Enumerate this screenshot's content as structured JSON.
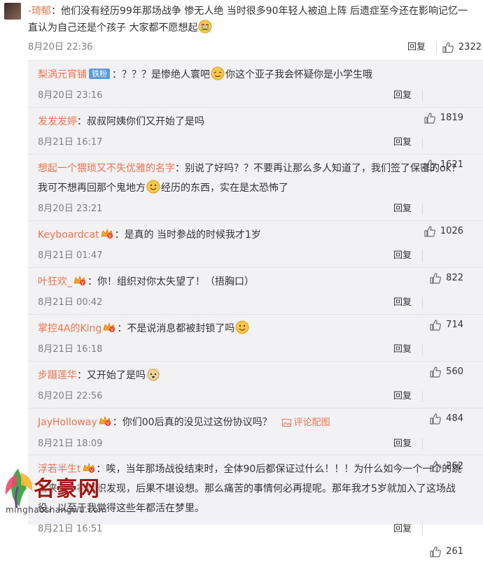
{
  "top_comment": {
    "username": "-琦郁",
    "text_before_emoji": "：他们没有经历99年那场战争 惨无人绝 当时很多90年轻人被迫上阵 后遗症至今还在影响记忆一直认为自己还是个孩子 大家都不愿想起",
    "emoji": "crying-face",
    "time": "8月20日 22:36",
    "reply_label": "回复",
    "likes": "2322"
  },
  "replies": [
    {
      "username": "梨涡元宵铺",
      "badge": "铁粉",
      "vip": false,
      "text": "：？？？是惨绝人寰吧",
      "emoji": "sweat-smile",
      "text_after": "你这个亚子我会怀疑你是小学生哦",
      "time": "8月20日 23:16",
      "reply_label": "回复",
      "likes": "1819"
    },
    {
      "username": "发发发婷",
      "badge": "",
      "vip": false,
      "text": "：叔叔阿姨你们又开始了是吗",
      "emoji": "",
      "text_after": "",
      "time": "8月21日 16:17",
      "reply_label": "回复",
      "likes": "1621"
    },
    {
      "username": "想起一个猥琐又不失优雅的名字",
      "badge": "",
      "vip": false,
      "text": "：别说了好吗？？不要再让那么多人知道了，我们签了保密的ok？我可不想再回那个鬼地方",
      "emoji": "smile",
      "text_after": "经历的东西，实在是太恐怖了",
      "time": "8月20日 23:21",
      "reply_label": "回复",
      "likes": "1026"
    },
    {
      "username": "Keyboardcat",
      "badge": "",
      "vip": true,
      "text": "：是真的 当时参战的时候我才1岁",
      "emoji": "",
      "text_after": "",
      "time": "8月21日 01:47",
      "reply_label": "回复",
      "likes": "822"
    },
    {
      "username": "叶狂欢_",
      "badge": "",
      "vip": true,
      "text": "：你！组织对你太失望了！（捂胸口）",
      "emoji": "",
      "text_after": "",
      "time": "8月21日 00:42",
      "reply_label": "回复",
      "likes": "714"
    },
    {
      "username": "掌控4A的King",
      "badge": "",
      "vip": true,
      "text": "：不是说消息都被封锁了吗",
      "emoji": "smile",
      "text_after": "",
      "time": "8月21日 16:18",
      "reply_label": "回复",
      "likes": "560"
    },
    {
      "username": "步蹑莲华",
      "badge": "",
      "vip": false,
      "text": "：又开始了是吗",
      "emoji": "doge",
      "text_after": "",
      "time": "8月20日 22:56",
      "reply_label": "回复",
      "likes": "484"
    },
    {
      "username": "JayHolloway",
      "badge": "",
      "vip": true,
      "text": "：你们00后真的没见过这份协议吗？",
      "emoji": "",
      "text_after": "",
      "pic_link": "评论配图",
      "time": "8月21日 18:09",
      "reply_label": "回复",
      "likes": "262"
    },
    {
      "username": "浮若半生t",
      "badge": "",
      "vip": true,
      "text": "：唉，当年那场战役结束时，全体90后都保证过什么！！！为什么如今一个一个的跳出来了？被组织发现，后果不堪设想。那么痛苦的事情何必再提呢。那年我才5岁就加入了这场战役，以至于我觉得这些年都活在梦里。",
      "emoji": "",
      "text_after": "",
      "time": "8月21日 16:51",
      "reply_label": "回复",
      "likes": "261"
    }
  ],
  "watermark": {
    "name": "名豪网",
    "url": "minghaoshangwu.com"
  },
  "colors": {
    "username": "#eb7350",
    "meta": "#808080",
    "reply_bg": "#f2f2f5",
    "badge_bg": "#5d9ad8",
    "watermark_red": "#a01414"
  }
}
